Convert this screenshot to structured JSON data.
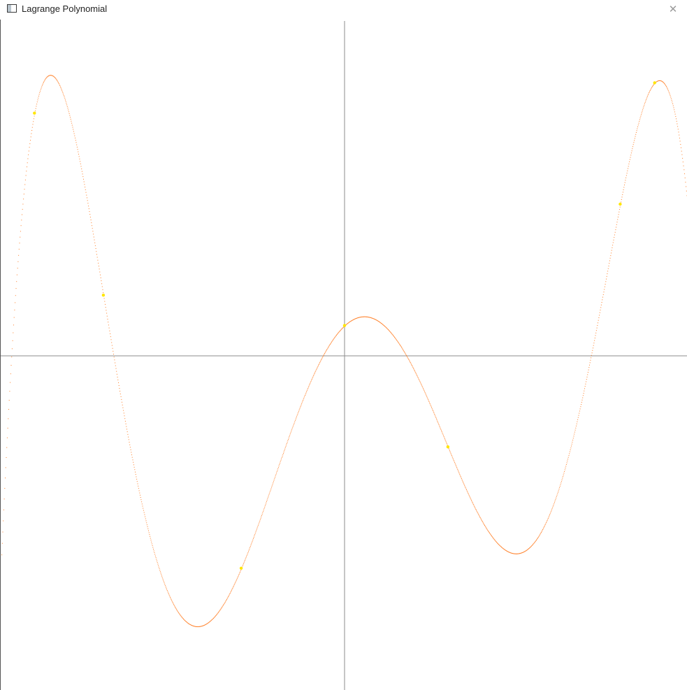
{
  "window": {
    "title": "Lagrange Polynomial",
    "icon": "app-window-icon",
    "close_icon": "close-icon"
  },
  "chart_data": {
    "type": "line",
    "title": "",
    "xlabel": "",
    "ylabel": "",
    "grid": false,
    "axes": "origin-crosshair",
    "xlim": [
      -10,
      10
    ],
    "ylim": [
      -10,
      10
    ],
    "colors": {
      "curve": "#ff7f27",
      "nodes": "#ffe600",
      "axes": "#8c8c8c"
    },
    "series": [
      {
        "kind": "interpolation-nodes",
        "x": [
          -9.0,
          -7.0,
          -3.0,
          0.0,
          3.0,
          8.0,
          9.0
        ],
        "y": [
          8.0,
          2.0,
          -7.0,
          1.0,
          -3.0,
          5.0,
          9.0
        ]
      }
    ]
  }
}
